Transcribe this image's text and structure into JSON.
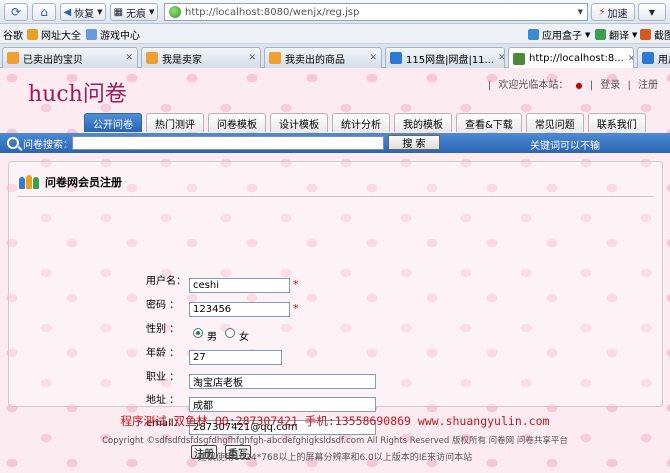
{
  "browser": {
    "toolbar": {
      "back_label": "恢复",
      "mode_label": "无痕",
      "url": "http://localhost:8080/wenjx/reg.jsp",
      "accelerate_label": "加速"
    },
    "bookmarks": {
      "left": [
        "谷歌",
        "网址大全",
        "游戏中心"
      ],
      "right": [
        "应用盒子",
        "翻译",
        "截图"
      ]
    },
    "tabs": [
      {
        "label": "已卖出的宝贝",
        "fav_color": "#f0a030"
      },
      {
        "label": "我是卖家",
        "fav_color": "#f0a030"
      },
      {
        "label": "我卖出的商品",
        "fav_color": "#f0a030"
      },
      {
        "label": "115网盘|网盘|11...",
        "fav_color": "#2a7ad6"
      },
      {
        "label": "http://localhost:8...",
        "fav_color": "#4a8a3a"
      },
      {
        "label": "用户中",
        "fav_color": "#2a7ad6"
      }
    ]
  },
  "site": {
    "logo": "huch问卷",
    "welcome": "欢迎光临本站：",
    "login": "登录",
    "register": "注册",
    "nav": [
      "公开问卷",
      "热门测评",
      "问卷模板",
      "设计模板",
      "统计分析",
      "我的模板",
      "查看&下载",
      "常见问题",
      "联系我们"
    ],
    "search": {
      "label": "问卷搜索：",
      "value": "",
      "button": "搜  索",
      "hint": "关键词可以不输"
    }
  },
  "form": {
    "title": "问卷网会员注册",
    "username_label": "用户名：",
    "username_value": "ceshi",
    "password_label": "密码  ：",
    "password_value": "123456",
    "gender_label": "性别  ：",
    "gender_male": "男",
    "gender_female": "女",
    "age_label": "年龄  ：",
    "age_value": "27",
    "job_label": "职业  ：",
    "job_value": "淘宝店老板",
    "address_label": "地址  ：",
    "address_value": "成都",
    "email_label": "email：",
    "email_value": "287307421@qq.com",
    "required_mark": "*",
    "submit": "注册",
    "reset": "重写"
  },
  "footer": {
    "line1": "程序测试:双鱼林 QQ:287307421 手机:13558690869 www.shuangyulin.com",
    "line2": "Copyright ©sdfsdfdsfdsgfdhgfhfghfgh-abcdefghigksldsdf.com All Rights Reserved 版权所有 问卷网  问卷共享平台",
    "line3": "建议使用1024*768以上的屏幕分辨率和6.0以上版本的IE来访问本站"
  }
}
